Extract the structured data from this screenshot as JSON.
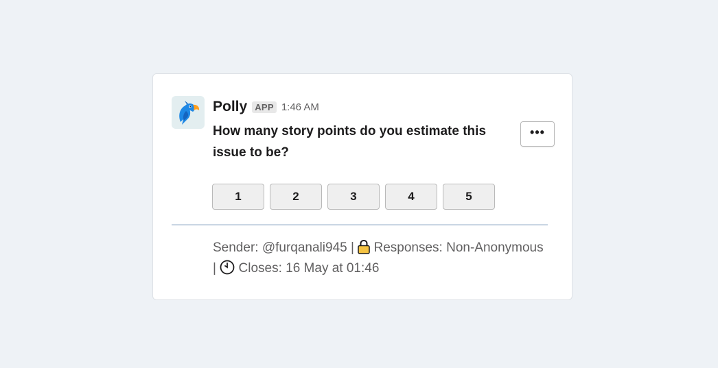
{
  "message": {
    "app_name": "Polly",
    "app_badge": "APP",
    "timestamp": "1:46 AM",
    "avatar_icon": "polly-parrot-logo",
    "question": "How many story points do you estimate this issue to be?",
    "more_label": "•••"
  },
  "options": [
    {
      "label": "1"
    },
    {
      "label": "2"
    },
    {
      "label": "3"
    },
    {
      "label": "4"
    },
    {
      "label": "5"
    }
  ],
  "footer": {
    "sender_label": "Sender: @furqanali945 |",
    "lock_icon": "lock-icon",
    "responses_label": "Responses: Non-Anonymous",
    "separator": "|",
    "clock_icon": "clock-icon",
    "closes_label": "Closes: 16 May at 01:46"
  },
  "colors": {
    "background": "#eef2f6",
    "card": "#ffffff",
    "button_bg": "#efefef",
    "divider": "#c9d6e3",
    "lock_color": "#f5c343",
    "parrot_blue": "#1e88e5",
    "parrot_orange": "#ff9f1c"
  }
}
